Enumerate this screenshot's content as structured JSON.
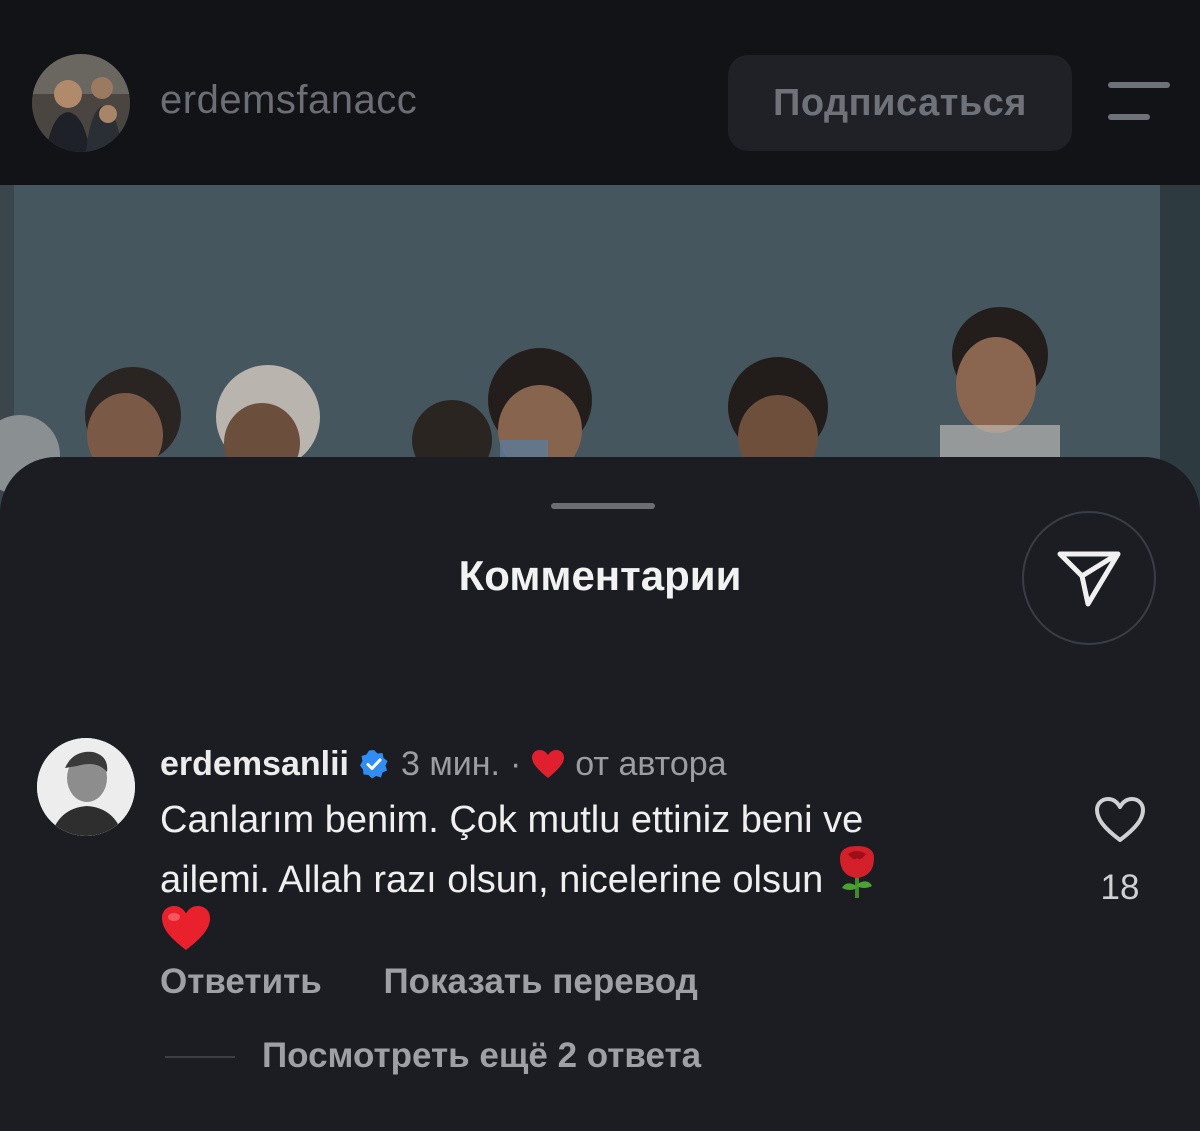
{
  "header": {
    "username": "erdemsfanacc",
    "follow_label": "Подписаться"
  },
  "comments_sheet": {
    "title": "Комментарии",
    "comment": {
      "username": "erdemsanlii",
      "time": "3 мин.",
      "separator": "·",
      "author_like_label": "от автора",
      "text_line1": "Canlarım benim. Çok mutlu ettiniz beni ve",
      "text_line2": "ailemi. Allah razı olsun, nicelerine olsun",
      "like_count": "18",
      "reply_label": "Ответить",
      "translate_label": "Показать перевод",
      "view_replies_label": "Посмотреть ещё 2 ответа"
    }
  },
  "icons": {
    "menu": "menu-icon",
    "send": "send-icon",
    "verified": "verified-badge-icon",
    "heart_red": "heart-icon",
    "rose": "rose-emoji",
    "like": "heart-outline-icon"
  },
  "colors": {
    "background": "#121317",
    "sheet": "#1b1d22",
    "verified": "#2f8df5",
    "heart": "#e0202e"
  }
}
